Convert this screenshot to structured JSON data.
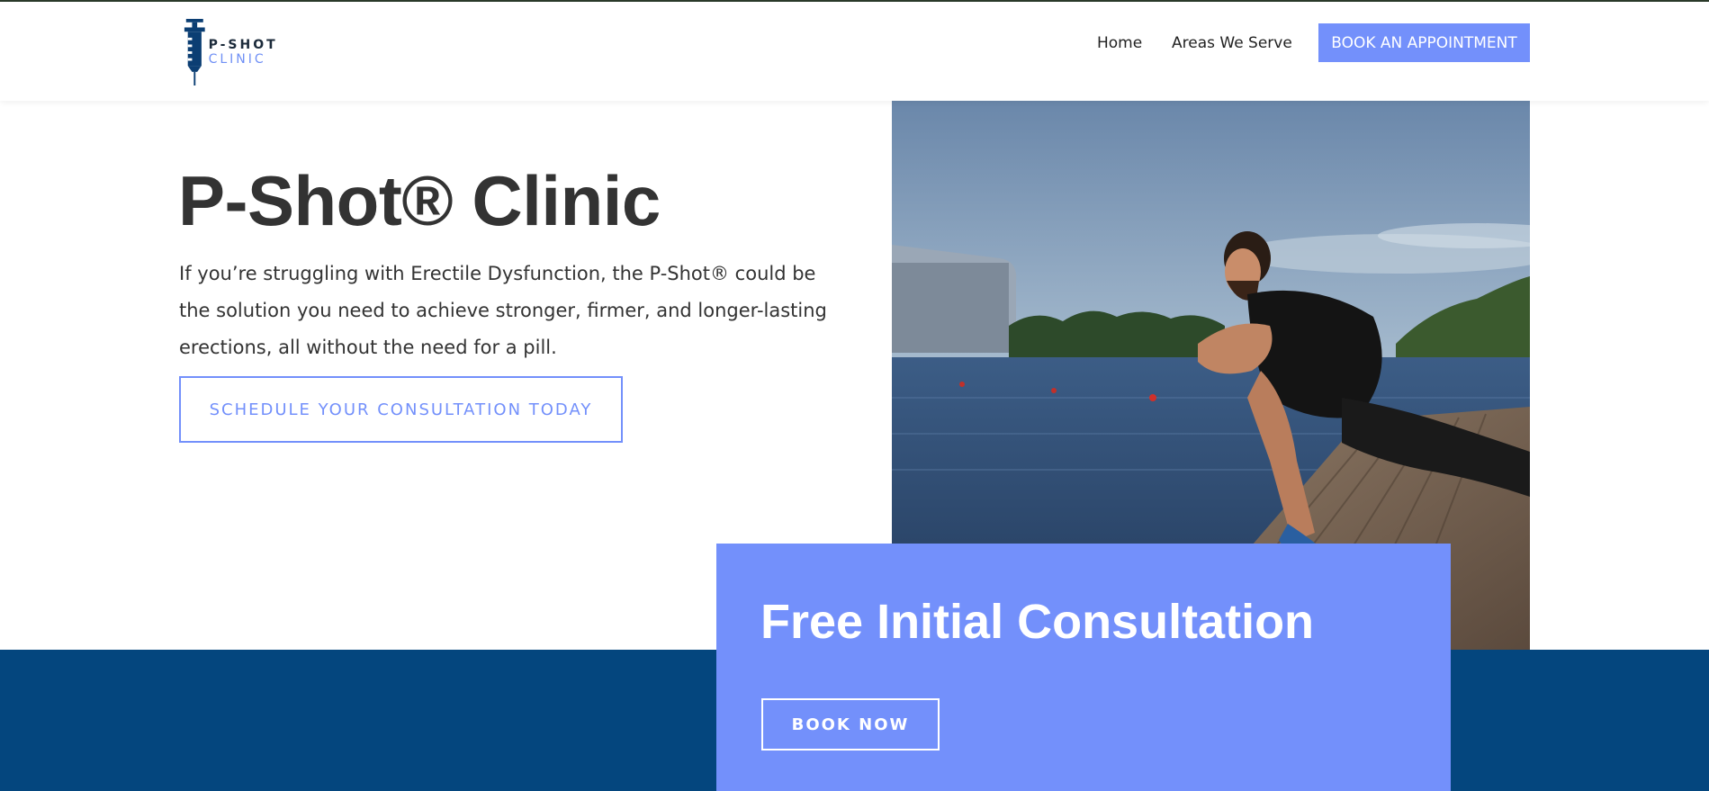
{
  "header": {
    "logo": {
      "text_main": "P-SHOT",
      "text_accent": "CLINIC"
    },
    "nav": {
      "home": "Home",
      "areas": "Areas We Serve"
    },
    "book_button": "BOOK AN APPOINTMENT"
  },
  "hero": {
    "title": "P-Shot® Clinic",
    "description": "If you’re struggling with Erectile Dysfunction, the P-Shot® could be the solution you need to achieve stronger, firmer, and longer-lasting erections, all without the need for a pill.",
    "cta_label": "SCHEDULE YOUR CONSULTATION TODAY"
  },
  "consultation": {
    "title": "Free Initial Consultation",
    "button_label": "BOOK NOW"
  },
  "colors": {
    "accent": "#7390fb",
    "band": "#04467e",
    "text": "#333333"
  }
}
